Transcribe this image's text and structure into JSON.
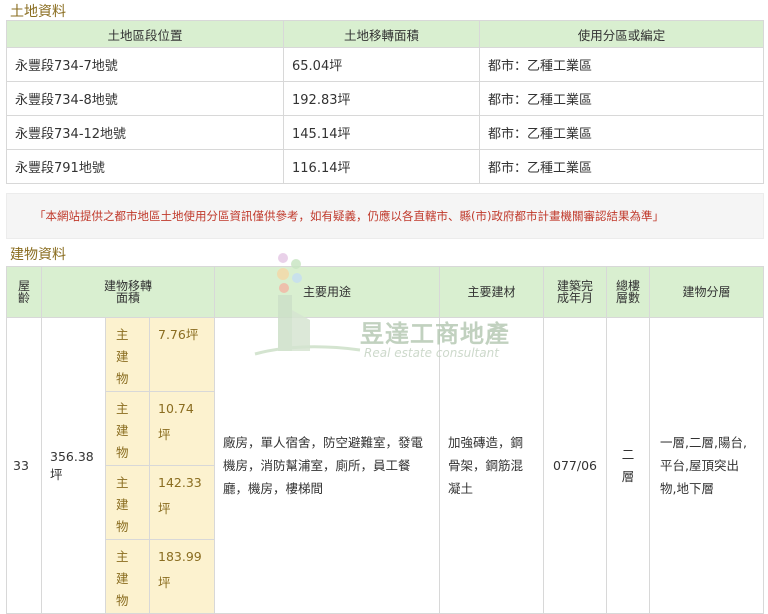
{
  "land": {
    "section_title": "土地資料",
    "headers": [
      "土地區段位置",
      "土地移轉面積",
      "使用分區或編定"
    ],
    "rows": [
      [
        "永豐段734-7地號",
        "65.04坪",
        "都市：乙種工業區"
      ],
      [
        "永豐段734-8地號",
        "192.83坪",
        "都市：乙種工業區"
      ],
      [
        "永豐段734-12地號",
        "145.14坪",
        "都市：乙種工業區"
      ],
      [
        "永豐段791地號",
        "116.14坪",
        "都市：乙種工業區"
      ]
    ]
  },
  "notice": "「本網站提供之都市地區土地使用分區資訊僅供參考，如有疑義，仍應以各直轄市、縣(市)政府都市計畫機關審認結果為準」",
  "building": {
    "section_title": "建物資料",
    "headers": {
      "age": "屋齡",
      "area": "建物移轉面積",
      "use": "主要用途",
      "material": "主要建材",
      "completed": "建築完成年月",
      "floors": "總樓層數",
      "layers": "建物分層"
    },
    "row": {
      "age": "33",
      "area": "356.38坪",
      "sub": [
        {
          "label": "主建物",
          "value": "7.76坪"
        },
        {
          "label": "主建物",
          "value": "10.74坪"
        },
        {
          "label": "主建物",
          "value": "142.33坪"
        },
        {
          "label": "主建物",
          "value": "183.99坪"
        }
      ],
      "use": "廠房，單人宿舍，防空避難室，發電機房，消防幫浦室，廁所，員工餐廳，機房，樓梯間",
      "material": "加強磚造，鋼骨架，鋼筋混凝土",
      "completed": "077/06",
      "floors": "二層",
      "layers": "一層,二層,陽台,平台,屋頂突出物,地下層"
    }
  },
  "watermark": {
    "name": "昱達工商地產",
    "tagline": "Real estate consultant"
  },
  "colors": {
    "header_bg": "#d9efd0",
    "sub_bg": "#fcf2cf",
    "notice_text": "#c0392b",
    "section_title": "#8a6d20"
  }
}
